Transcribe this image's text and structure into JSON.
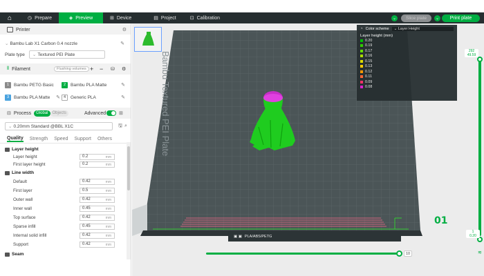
{
  "topbar": {
    "tabs": [
      {
        "label": "Prepare",
        "active": false
      },
      {
        "label": "Preview",
        "active": true
      },
      {
        "label": "Device",
        "active": false
      },
      {
        "label": "Project",
        "active": false
      },
      {
        "label": "Calibration",
        "active": false
      }
    ],
    "slice_label": "Slice plate",
    "print_label": "Print plate"
  },
  "printer": {
    "section_label": "Printer",
    "printer_name": "Bambu Lab X1 Carbon 0.4 nozzle",
    "plate_type_label": "Plate type",
    "plate_type_value": "Textured PEI Plate"
  },
  "filament": {
    "section_label": "Filament",
    "flushing_label": "Flushing volumes",
    "items": [
      {
        "num": "1",
        "name": "Bambu PETG Basic",
        "color": "#8b8b8b"
      },
      {
        "num": "2",
        "name": "Bambu PLA Matte",
        "color": "#00ae42"
      },
      {
        "num": "3",
        "name": "Bambu PLA Matte",
        "color": "#4aa3df"
      },
      {
        "num": "4",
        "name": "Generic PLA",
        "color": "#ffffff"
      }
    ]
  },
  "process": {
    "section_label": "Process",
    "global_label": "Global",
    "objects_label": "Objects",
    "advanced_label": "Advanced",
    "preset": "0.20mm Standard @BBL X1C",
    "tabs": [
      "Quality",
      "Strength",
      "Speed",
      "Support",
      "Others"
    ],
    "groups": [
      {
        "title": "Layer height",
        "params": [
          {
            "label": "Layer height",
            "value": "0.2",
            "unit": "mm"
          },
          {
            "label": "First layer height",
            "value": "0.2",
            "unit": "mm"
          }
        ]
      },
      {
        "title": "Line width",
        "params": [
          {
            "label": "Default",
            "value": "0.42",
            "unit": "mm"
          },
          {
            "label": "First layer",
            "value": "0.5",
            "unit": "mm"
          },
          {
            "label": "Outer wall",
            "value": "0.42",
            "unit": "mm"
          },
          {
            "label": "Inner wall",
            "value": "0.45",
            "unit": "mm"
          },
          {
            "label": "Top surface",
            "value": "0.42",
            "unit": "mm"
          },
          {
            "label": "Sparse infill",
            "value": "0.45",
            "unit": "mm"
          },
          {
            "label": "Internal solid infill",
            "value": "0.42",
            "unit": "mm"
          },
          {
            "label": "Support",
            "value": "0.42",
            "unit": "mm"
          }
        ]
      },
      {
        "title": "Seam",
        "params": []
      }
    ]
  },
  "legend": {
    "color_scheme_label": "Color scheme",
    "color_scheme_value": "Layer Height",
    "title": "Layer height (mm)",
    "entries": [
      {
        "label": "0.20",
        "color": "#00c000"
      },
      {
        "label": "0.19",
        "color": "#33cc00"
      },
      {
        "label": "0.17",
        "color": "#66dd00"
      },
      {
        "label": "0.16",
        "color": "#aadd00"
      },
      {
        "label": "0.15",
        "color": "#dddd00"
      },
      {
        "label": "0.13",
        "color": "#ffcc00"
      },
      {
        "label": "0.12",
        "color": "#ff9900"
      },
      {
        "label": "0.11",
        "color": "#ff6633"
      },
      {
        "label": "0.09",
        "color": "#ff3366"
      },
      {
        "label": "0.08",
        "color": "#dd22cc"
      }
    ]
  },
  "viewport": {
    "bed_text": "Bambu Textured PEI Plate",
    "plate_number": "01",
    "plate_bar_text": "PLA/ABS/PETG",
    "hslider_value": "10",
    "vslider_top_line1": "292",
    "vslider_top_line2": "49.59",
    "vslider_bottom_line1": "1",
    "vslider_bottom_line2": "0.20"
  }
}
